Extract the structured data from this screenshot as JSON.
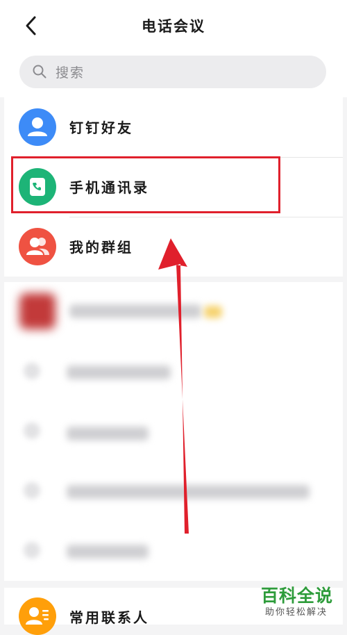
{
  "header": {
    "title": "电话会议",
    "back_icon": "chevron-left-icon"
  },
  "search": {
    "placeholder": "搜索",
    "icon": "search-icon"
  },
  "menu": {
    "items": [
      {
        "label": "钉钉好友",
        "icon": "person-icon",
        "color": "#3d8bf7"
      },
      {
        "label": "手机通讯录",
        "icon": "phone-book-icon",
        "color": "#1db477"
      },
      {
        "label": "我的群组",
        "icon": "group-icon",
        "color": "#ef5242"
      }
    ],
    "highlighted_index": 1
  },
  "bottom_item": {
    "label": "常用联系人",
    "icon": "contact-card-icon",
    "color": "#ff9f0a"
  },
  "annotation": {
    "arrow_color": "#e0202c",
    "highlight_color": "#e0202c"
  },
  "watermark": {
    "title": "百科全说",
    "subtitle": "助你轻松解决"
  }
}
